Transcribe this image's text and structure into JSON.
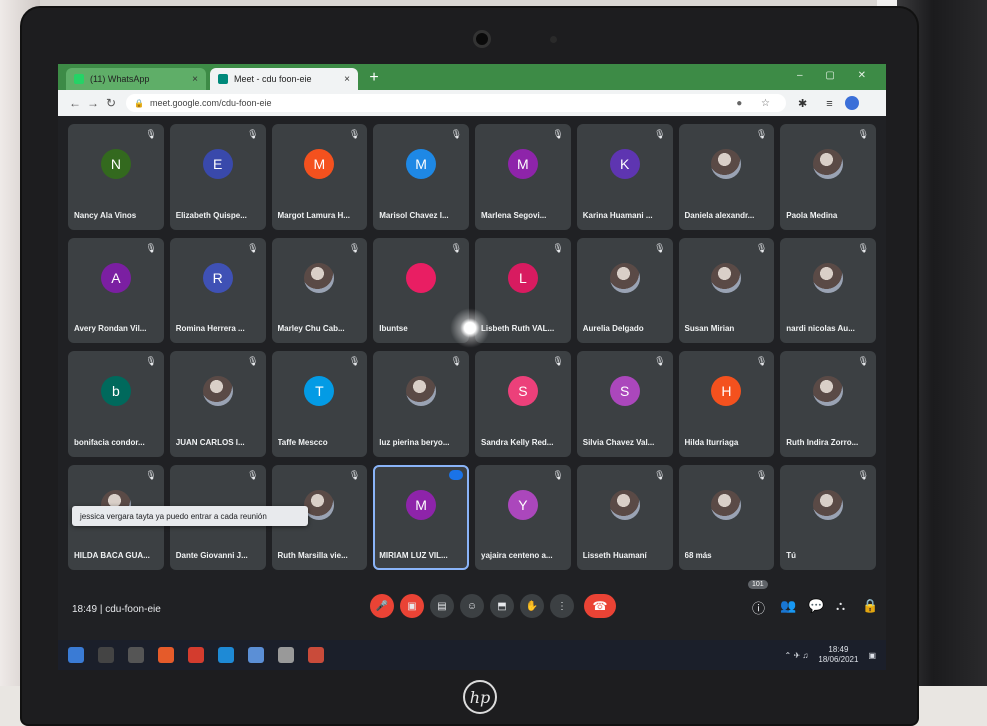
{
  "browser": {
    "tabs": [
      {
        "label": "(11) WhatsApp",
        "close": "×"
      },
      {
        "label": "Meet - cdu foon-eie",
        "close": "×"
      }
    ],
    "new_tab": "+",
    "url": "meet.google.com/cdu-foon-eie"
  },
  "participants": [
    {
      "name": "Nancy Ala Vinos",
      "initial": "N",
      "color": "#33691e",
      "type": "initial"
    },
    {
      "name": "Elizabeth Quispe...",
      "initial": "E",
      "color": "#3949ab",
      "type": "initial"
    },
    {
      "name": "Margot Lamura H...",
      "initial": "M",
      "color": "#f4511e",
      "type": "initial"
    },
    {
      "name": "Marisol Chavez I...",
      "initial": "M",
      "color": "#1e88e5",
      "type": "initial"
    },
    {
      "name": "Marlena Segovi...",
      "initial": "M",
      "color": "#8e24aa",
      "type": "initial"
    },
    {
      "name": "Karina Huamani ...",
      "initial": "K",
      "color": "#5e35b1",
      "type": "initial"
    },
    {
      "name": "Daniela alexandr...",
      "initial": "",
      "color": "",
      "type": "photo"
    },
    {
      "name": "Paola Medina",
      "initial": "",
      "color": "",
      "type": "photo"
    },
    {
      "name": "Avery Rondan Vil...",
      "initial": "A",
      "color": "#7b1fa2",
      "type": "initial"
    },
    {
      "name": "Romina Herrera ...",
      "initial": "R",
      "color": "#3f51b5",
      "type": "initial"
    },
    {
      "name": "Marley Chu Cab...",
      "initial": "",
      "color": "",
      "type": "photo"
    },
    {
      "name": "Ibuntse",
      "initial": "",
      "color": "#e91e63",
      "type": "initial"
    },
    {
      "name": "Lisbeth Ruth VAL...",
      "initial": "L",
      "color": "#d81b60",
      "type": "initial"
    },
    {
      "name": "Aurelia Delgado",
      "initial": "",
      "color": "",
      "type": "photo"
    },
    {
      "name": "Susan Mirian",
      "initial": "",
      "color": "",
      "type": "photo"
    },
    {
      "name": "nardi nicolas Au...",
      "initial": "",
      "color": "",
      "type": "photo"
    },
    {
      "name": "bonifacia condor...",
      "initial": "b",
      "color": "#00695c",
      "type": "initial"
    },
    {
      "name": "JUAN CARLOS I...",
      "initial": "",
      "color": "",
      "type": "photo"
    },
    {
      "name": "Taffe Mescco",
      "initial": "T",
      "color": "#039be5",
      "type": "initial"
    },
    {
      "name": "luz pierina beryo...",
      "initial": "",
      "color": "",
      "type": "photo"
    },
    {
      "name": "Sandra Kelly Red...",
      "initial": "S",
      "color": "#ec407a",
      "type": "initial"
    },
    {
      "name": "Silvia Chavez Val...",
      "initial": "S",
      "color": "#ab47bc",
      "type": "initial"
    },
    {
      "name": "Hilda Iturriaga",
      "initial": "H",
      "color": "#f4511e",
      "type": "initial"
    },
    {
      "name": "Ruth Indira Zorro...",
      "initial": "",
      "color": "",
      "type": "photo"
    },
    {
      "name": "HILDA BACA GUA...",
      "initial": "",
      "color": "",
      "type": "photo"
    },
    {
      "name": "Dante Giovanni J...",
      "initial": "",
      "color": "",
      "type": "none"
    },
    {
      "name": "Ruth Marsilla vie...",
      "initial": "",
      "color": "",
      "type": "photo"
    },
    {
      "name": "MIRIAM LUZ VIL...",
      "initial": "M",
      "color": "#8e24aa",
      "type": "initial"
    },
    {
      "name": "yajaira centeno a...",
      "initial": "Y",
      "color": "#ab47bc",
      "type": "initial"
    },
    {
      "name": "Lisseth Huamaní",
      "initial": "",
      "color": "",
      "type": "photo"
    },
    {
      "name": "68 más",
      "initial": "",
      "color": "",
      "type": "group"
    },
    {
      "name": "Tú",
      "initial": "",
      "color": "",
      "type": "photo"
    }
  ],
  "notification": "jessica vergara tayta ya puedo entrar a cada reunión",
  "meeting": {
    "time": "18:49",
    "separator": "|",
    "code": "cdu-foon-eie"
  },
  "people_count": "101",
  "taskbar": {
    "time": "18:49",
    "date": "18/06/2021"
  },
  "brand": "hp"
}
